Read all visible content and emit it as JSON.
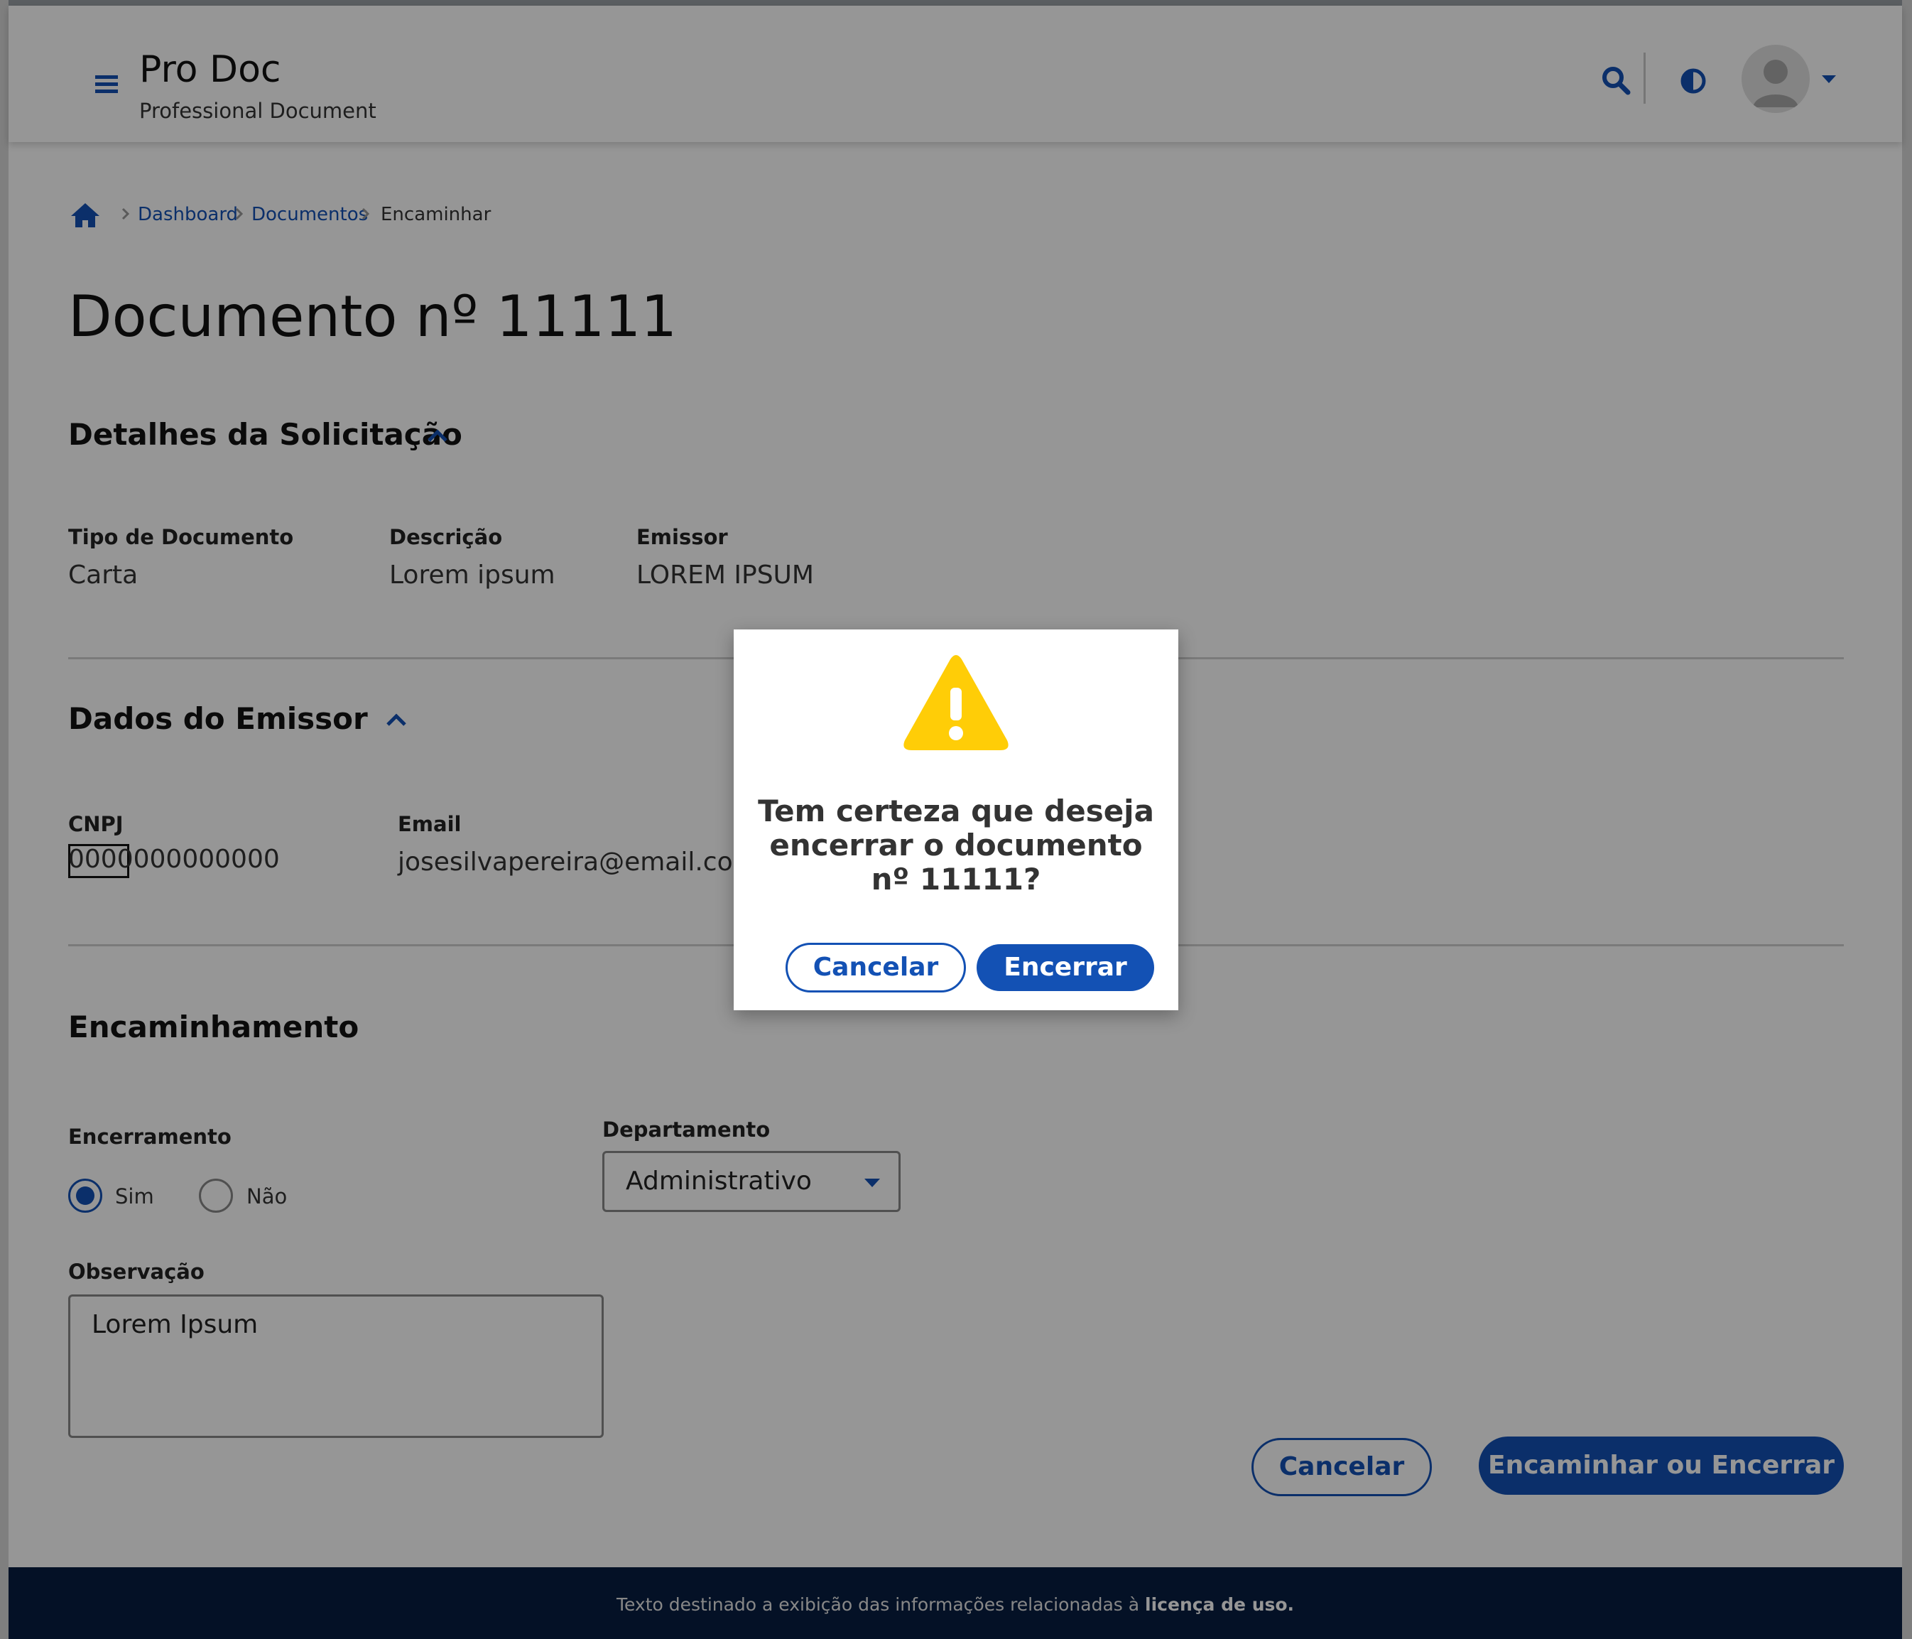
{
  "header": {
    "app_title": "Pro Doc",
    "app_subtitle": "Professional Document"
  },
  "breadcrumb": {
    "items": [
      "Dashboard",
      "Documentos"
    ],
    "current": "Encaminhar"
  },
  "page_title": "Documento nº 11111",
  "section_details": {
    "title": "Detalhes da Solicitação",
    "fields": [
      {
        "label": "Tipo de Documento",
        "value": "Carta"
      },
      {
        "label": "Descrição",
        "value": "Lorem ipsum"
      },
      {
        "label": "Emissor",
        "value": "LOREM IPSUM"
      }
    ]
  },
  "section_issuer": {
    "title": "Dados do Emissor",
    "fields": [
      {
        "label": "CNPJ",
        "value": "0000000000000"
      },
      {
        "label": "Email",
        "value": "josesilvapereira@email.com"
      }
    ]
  },
  "section_forward": {
    "title": "Encaminhamento",
    "closing_label": "Encerramento",
    "radio_options": [
      {
        "label": "Sim",
        "checked": true
      },
      {
        "label": "Não",
        "checked": false
      }
    ],
    "department_label": "Departamento",
    "department_value": "Administrativo",
    "observation_label": "Observação",
    "observation_value": "Lorem Ipsum"
  },
  "actions": {
    "cancel_label": "Cancelar",
    "submit_label": "Encaminhar ou Encerrar"
  },
  "footer": {
    "text": "Texto destinado a exibição das informações relacionadas à ",
    "bold_text": "licença de uso."
  },
  "modal": {
    "message": "Tem certeza que deseja encerrar o documento nº 11111?",
    "cancel_label": "Cancelar",
    "confirm_label": "Encerrar"
  },
  "icons": {
    "menu": "menu-icon",
    "search": "search-icon",
    "contrast": "contrast-icon",
    "avatar": "user-avatar",
    "home": "home-icon",
    "warning": "warning-icon"
  },
  "colors": {
    "primary": "#1351b4",
    "footer_bg": "#071d41",
    "warning": "#ffcd07"
  }
}
